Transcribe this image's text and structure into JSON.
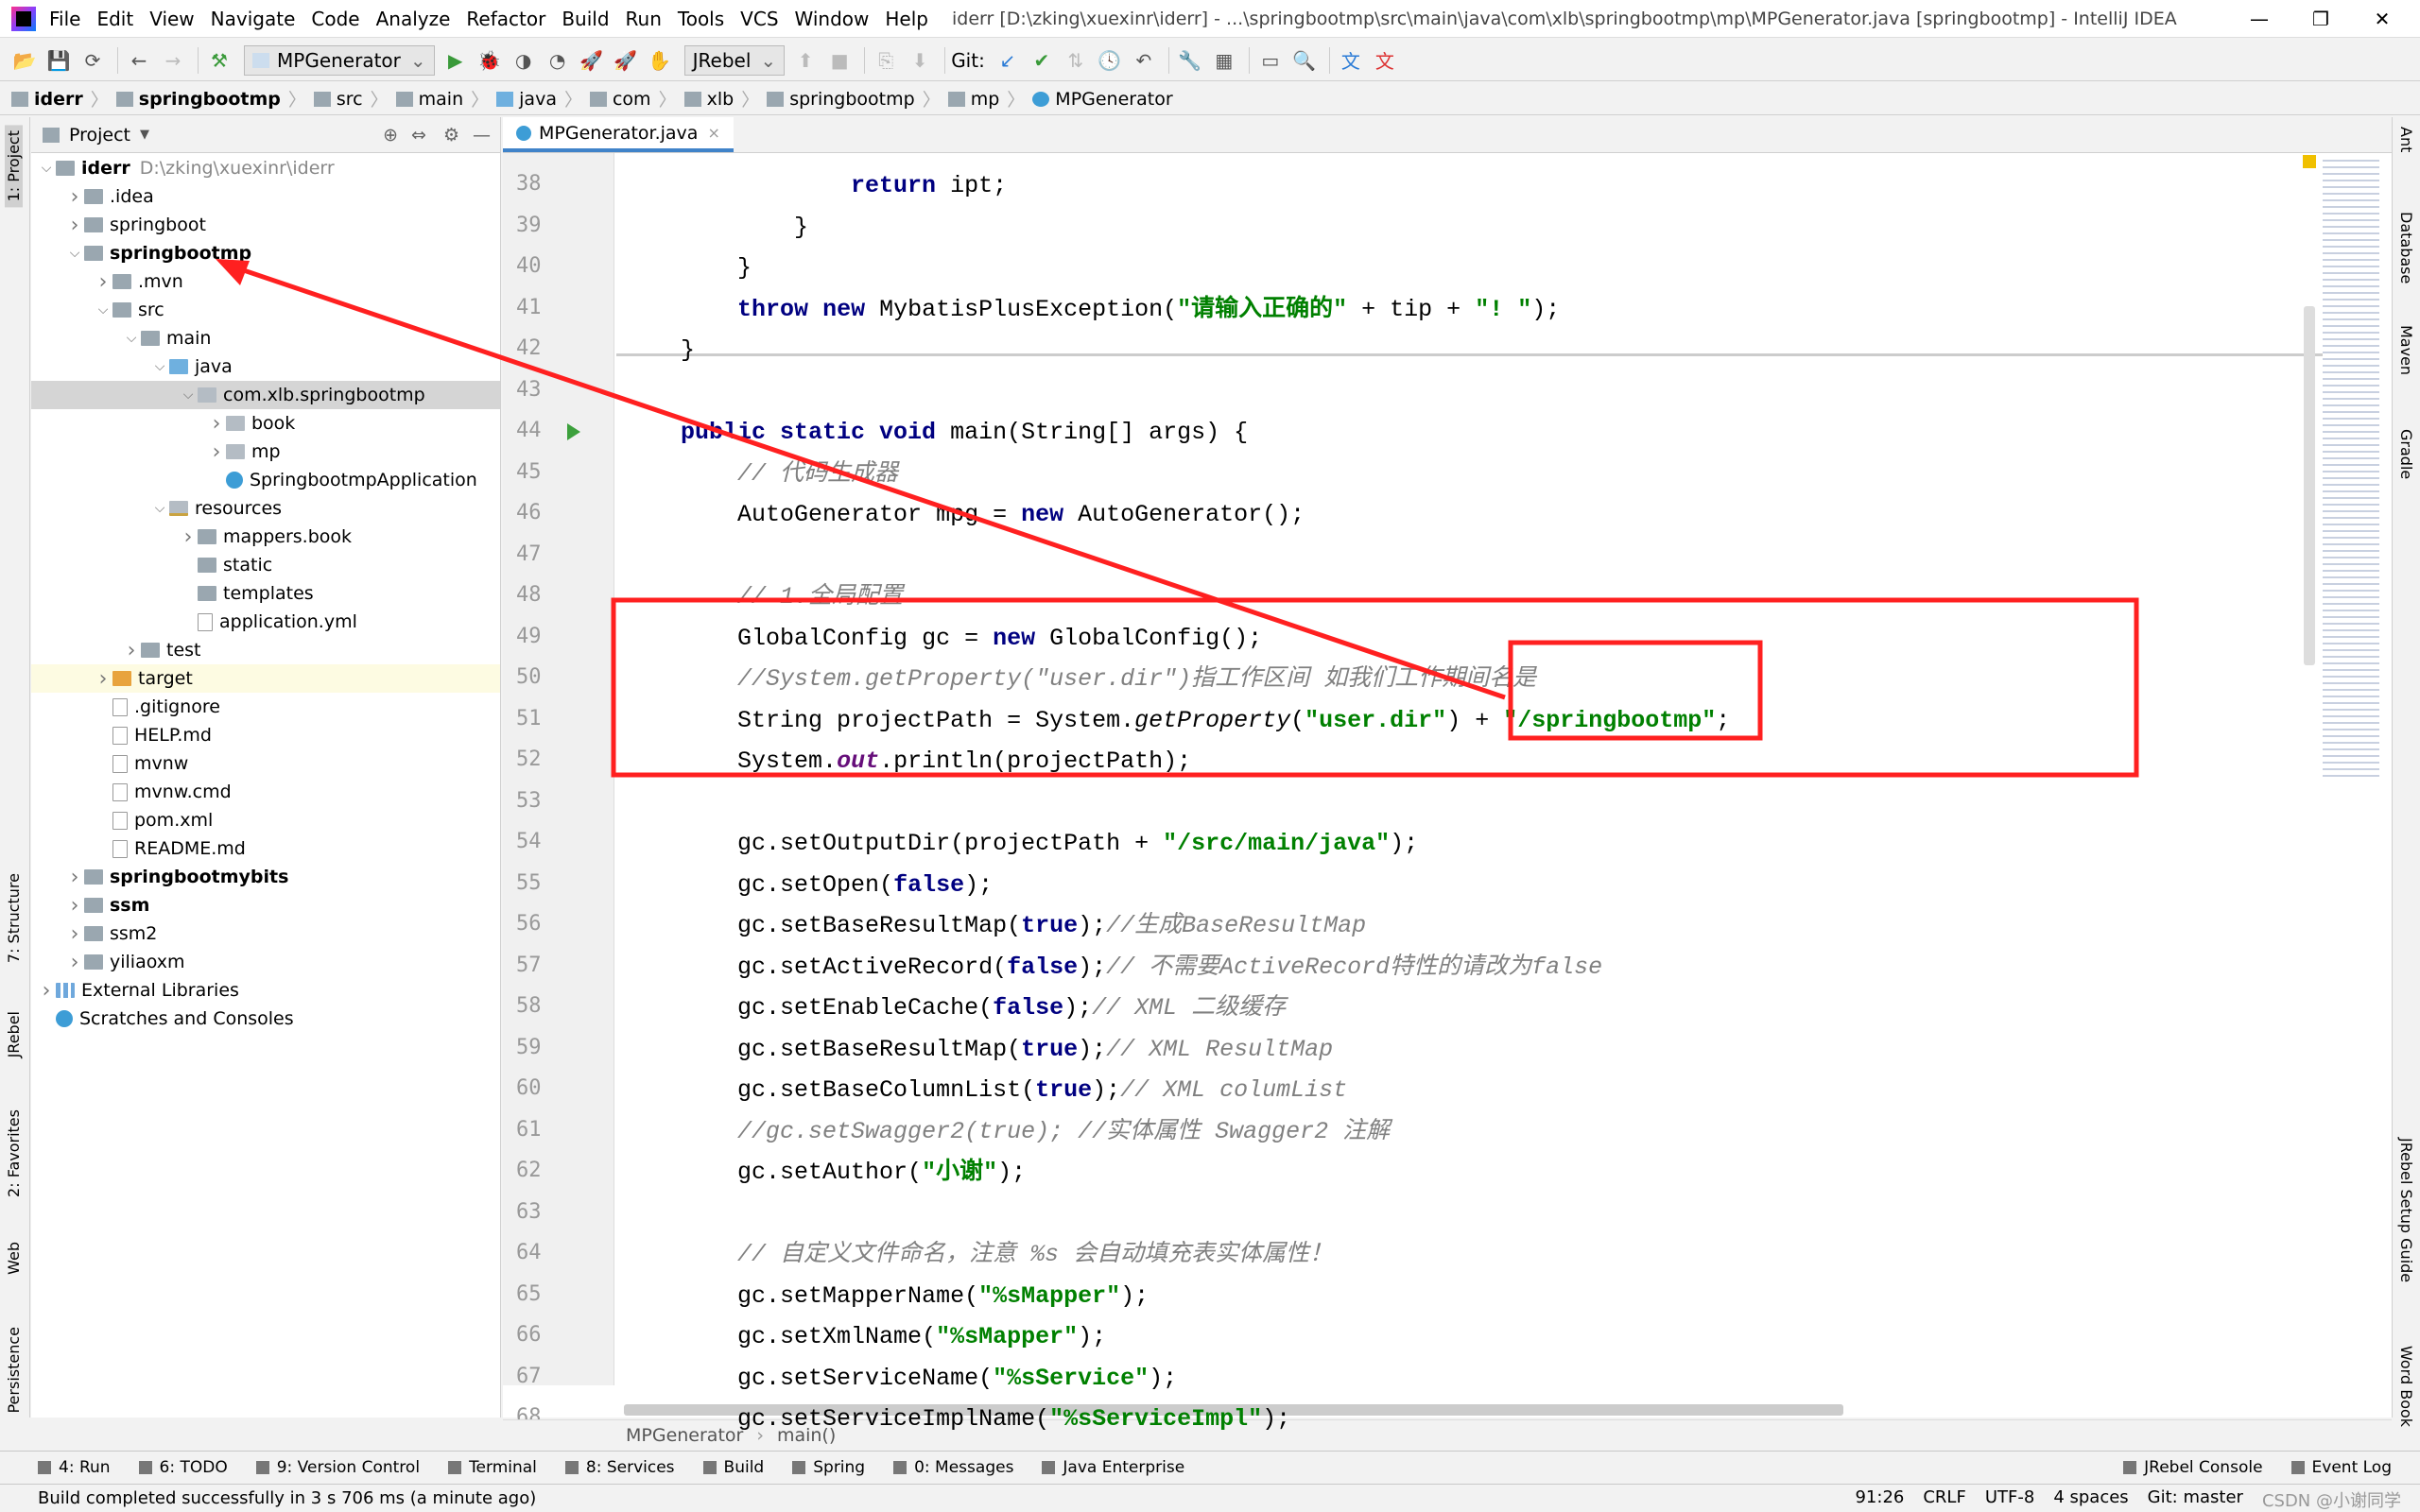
{
  "window": {
    "title": "iderr [D:\\zking\\xuexinr\\iderr] - ...\\springbootmp\\src\\main\\java\\com\\xlb\\springbootmp\\mp\\MPGenerator.java [springbootmp] - IntelliJ IDEA",
    "minimize": "—",
    "maximize": "❐",
    "close": "✕"
  },
  "menu": [
    "File",
    "Edit",
    "View",
    "Navigate",
    "Code",
    "Analyze",
    "Refactor",
    "Build",
    "Run",
    "Tools",
    "VCS",
    "Window",
    "Help"
  ],
  "toolbar": {
    "run_config": "MPGenerator",
    "jrebel": "JRebel",
    "git_label": "Git:"
  },
  "breadcrumb": [
    "iderr",
    "springbootmp",
    "src",
    "main",
    "java",
    "com",
    "xlb",
    "springbootmp",
    "mp",
    "MPGenerator"
  ],
  "project_panel": {
    "title": "Project",
    "tree": [
      {
        "label": "iderr",
        "extra": "D:\\zking\\xuexinr\\iderr",
        "level": 0,
        "arrow": "v",
        "type": "mod",
        "bold": true
      },
      {
        "label": ".idea",
        "level": 1,
        "arrow": ">",
        "type": "dir"
      },
      {
        "label": "springboot",
        "level": 1,
        "arrow": ">",
        "type": "mod"
      },
      {
        "label": "springbootmp",
        "level": 1,
        "arrow": "v",
        "type": "mod",
        "bold": true
      },
      {
        "label": ".mvn",
        "level": 2,
        "arrow": ">",
        "type": "dir"
      },
      {
        "label": "src",
        "level": 2,
        "arrow": "v",
        "type": "dir"
      },
      {
        "label": "main",
        "level": 3,
        "arrow": "v",
        "type": "dir"
      },
      {
        "label": "java",
        "level": 4,
        "arrow": "v",
        "type": "src"
      },
      {
        "label": "com.xlb.springbootmp",
        "level": 5,
        "arrow": "v",
        "type": "pkg",
        "state": "selected"
      },
      {
        "label": "book",
        "level": 6,
        "arrow": ">",
        "type": "pkg"
      },
      {
        "label": "mp",
        "level": 6,
        "arrow": ">",
        "type": "pkg"
      },
      {
        "label": "SpringbootmpApplication",
        "level": 6,
        "arrow": "",
        "type": "cls"
      },
      {
        "label": "resources",
        "level": 4,
        "arrow": "v",
        "type": "res"
      },
      {
        "label": "mappers.book",
        "level": 5,
        "arrow": ">",
        "type": "dir"
      },
      {
        "label": "static",
        "level": 5,
        "arrow": "",
        "type": "dir"
      },
      {
        "label": "templates",
        "level": 5,
        "arrow": "",
        "type": "dir"
      },
      {
        "label": "application.yml",
        "level": 5,
        "arrow": "",
        "type": "file"
      },
      {
        "label": "test",
        "level": 3,
        "arrow": ">",
        "type": "dir"
      },
      {
        "label": "target",
        "level": 2,
        "arrow": ">",
        "type": "target",
        "state": "excluded"
      },
      {
        "label": ".gitignore",
        "level": 2,
        "arrow": "",
        "type": "file"
      },
      {
        "label": "HELP.md",
        "level": 2,
        "arrow": "",
        "type": "file"
      },
      {
        "label": "mvnw",
        "level": 2,
        "arrow": "",
        "type": "file"
      },
      {
        "label": "mvnw.cmd",
        "level": 2,
        "arrow": "",
        "type": "file"
      },
      {
        "label": "pom.xml",
        "level": 2,
        "arrow": "",
        "type": "file"
      },
      {
        "label": "README.md",
        "level": 2,
        "arrow": "",
        "type": "file"
      },
      {
        "label": "springbootmybits",
        "level": 1,
        "arrow": ">",
        "type": "mod",
        "bold": true
      },
      {
        "label": "ssm",
        "level": 1,
        "arrow": ">",
        "type": "mod",
        "bold": true
      },
      {
        "label": "ssm2",
        "level": 1,
        "arrow": ">",
        "type": "mod"
      },
      {
        "label": "yiliaoxm",
        "level": 1,
        "arrow": ">",
        "type": "mod"
      },
      {
        "label": "External Libraries",
        "level": 0,
        "arrow": ">",
        "type": "lib"
      },
      {
        "label": "Scratches and Consoles",
        "level": 0,
        "arrow": "",
        "type": "scr"
      }
    ]
  },
  "editor": {
    "tab": "MPGenerator.java",
    "tab_close": "×",
    "lines": [
      {
        "n": "38",
        "indent": 16,
        "t": [
          [
            "kw",
            "return"
          ],
          [
            "pl",
            " ipt;"
          ]
        ]
      },
      {
        "n": "39",
        "indent": 12,
        "t": [
          [
            "pl",
            "}"
          ]
        ]
      },
      {
        "n": "40",
        "indent": 8,
        "t": [
          [
            "pl",
            "}"
          ]
        ]
      },
      {
        "n": "41",
        "indent": 8,
        "t": [
          [
            "kw",
            "throw"
          ],
          [
            "pl",
            " "
          ],
          [
            "kw",
            "new"
          ],
          [
            "pl",
            " MybatisPlusException("
          ],
          [
            "str",
            "\"请输入正确的\""
          ],
          [
            "pl",
            " + tip + "
          ],
          [
            "str",
            "\"! \""
          ],
          [
            "pl",
            ");"
          ]
        ]
      },
      {
        "n": "42",
        "indent": 4,
        "t": [
          [
            "pl",
            "}"
          ]
        ]
      },
      {
        "n": "43",
        "indent": 0,
        "t": []
      },
      {
        "n": "44",
        "indent": 4,
        "run": true,
        "t": [
          [
            "kw",
            "public static void"
          ],
          [
            "pl",
            " main(String[] args) {"
          ]
        ]
      },
      {
        "n": "45",
        "indent": 8,
        "t": [
          [
            "cm",
            "// 代码生成器"
          ]
        ]
      },
      {
        "n": "46",
        "indent": 8,
        "t": [
          [
            "pl",
            "AutoGenerator mpg = "
          ],
          [
            "kw",
            "new"
          ],
          [
            "pl",
            " AutoGenerator();"
          ]
        ]
      },
      {
        "n": "47",
        "indent": 0,
        "t": []
      },
      {
        "n": "48",
        "indent": 8,
        "t": [
          [
            "cm",
            "// 1.全局配置"
          ]
        ]
      },
      {
        "n": "49",
        "indent": 8,
        "t": [
          [
            "pl",
            "GlobalConfig gc = "
          ],
          [
            "kw",
            "new"
          ],
          [
            "pl",
            " GlobalConfig();"
          ]
        ]
      },
      {
        "n": "50",
        "indent": 8,
        "t": [
          [
            "cm",
            "//System.getProperty(\"user.dir\")指工作区间 如我们工作期间名是"
          ]
        ]
      },
      {
        "n": "51",
        "indent": 8,
        "t": [
          [
            "pl",
            "String projectPath = System."
          ],
          [
            "it",
            "getProperty"
          ],
          [
            "pl",
            "("
          ],
          [
            "str",
            "\"user.dir\""
          ],
          [
            "pl",
            ") + "
          ],
          [
            "str",
            "\"/springbootmp\""
          ],
          [
            "pl",
            ";"
          ]
        ]
      },
      {
        "n": "52",
        "indent": 8,
        "t": [
          [
            "pl",
            "System."
          ],
          [
            "fld",
            "out"
          ],
          [
            "pl",
            ".println(projectPath);"
          ]
        ]
      },
      {
        "n": "53",
        "indent": 0,
        "t": []
      },
      {
        "n": "54",
        "indent": 8,
        "t": [
          [
            "pl",
            "gc.setOutputDir(projectPath + "
          ],
          [
            "str",
            "\"/src/main/java\""
          ],
          [
            "pl",
            ");"
          ]
        ]
      },
      {
        "n": "55",
        "indent": 8,
        "t": [
          [
            "pl",
            "gc.setOpen("
          ],
          [
            "kw",
            "false"
          ],
          [
            "pl",
            ");"
          ]
        ]
      },
      {
        "n": "56",
        "indent": 8,
        "t": [
          [
            "pl",
            "gc.setBaseResultMap("
          ],
          [
            "kw",
            "true"
          ],
          [
            "pl",
            ");"
          ],
          [
            "cm",
            "//生成BaseResultMap"
          ]
        ]
      },
      {
        "n": "57",
        "indent": 8,
        "t": [
          [
            "pl",
            "gc.setActiveRecord("
          ],
          [
            "kw",
            "false"
          ],
          [
            "pl",
            ");"
          ],
          [
            "cm",
            "// 不需要ActiveRecord特性的请改为false"
          ]
        ]
      },
      {
        "n": "58",
        "indent": 8,
        "t": [
          [
            "pl",
            "gc.setEnableCache("
          ],
          [
            "kw",
            "false"
          ],
          [
            "pl",
            ");"
          ],
          [
            "cm",
            "// XML 二级缓存"
          ]
        ]
      },
      {
        "n": "59",
        "indent": 8,
        "t": [
          [
            "pl",
            "gc.setBaseResultMap("
          ],
          [
            "kw",
            "true"
          ],
          [
            "pl",
            ");"
          ],
          [
            "cm",
            "// XML ResultMap"
          ]
        ]
      },
      {
        "n": "60",
        "indent": 8,
        "t": [
          [
            "pl",
            "gc.setBaseColumnList("
          ],
          [
            "kw",
            "true"
          ],
          [
            "pl",
            ");"
          ],
          [
            "cm",
            "// XML columList"
          ]
        ]
      },
      {
        "n": "61",
        "indent": 8,
        "t": [
          [
            "cm",
            "//gc.setSwagger2(true); //实体属性 Swagger2 注解"
          ]
        ]
      },
      {
        "n": "62",
        "indent": 8,
        "t": [
          [
            "pl",
            "gc.setAuthor("
          ],
          [
            "str",
            "\"小谢\""
          ],
          [
            "pl",
            ");"
          ]
        ]
      },
      {
        "n": "63",
        "indent": 0,
        "t": []
      },
      {
        "n": "64",
        "indent": 8,
        "t": [
          [
            "cm",
            "// 自定义文件命名，注意 %s 会自动填充表实体属性！"
          ]
        ]
      },
      {
        "n": "65",
        "indent": 8,
        "t": [
          [
            "pl",
            "gc.setMapperName("
          ],
          [
            "str",
            "\"%sMapper\""
          ],
          [
            "pl",
            ");"
          ]
        ]
      },
      {
        "n": "66",
        "indent": 8,
        "t": [
          [
            "pl",
            "gc.setXmlName("
          ],
          [
            "str",
            "\"%sMapper\""
          ],
          [
            "pl",
            ");"
          ]
        ]
      },
      {
        "n": "67",
        "indent": 8,
        "t": [
          [
            "pl",
            "gc.setServiceName("
          ],
          [
            "str",
            "\"%sService\""
          ],
          [
            "pl",
            ");"
          ]
        ]
      },
      {
        "n": "68",
        "indent": 8,
        "t": [
          [
            "pl",
            "gc.setServiceImplName("
          ],
          [
            "str",
            "\"%sServiceImpl\""
          ],
          [
            "pl",
            ");"
          ]
        ]
      }
    ],
    "breadcrumb": [
      "MPGenerator",
      "main()"
    ]
  },
  "left_strip": [
    "1: Project",
    "7: Structure",
    "JRebel",
    "2: Favorites",
    "Web",
    "Persistence"
  ],
  "right_strip": [
    "Ant",
    "Database",
    "Maven",
    "Gradle",
    "JRebel Setup Guide",
    "Word Book"
  ],
  "tool_windows": [
    "4: Run",
    "6: TODO",
    "9: Version Control",
    "Terminal",
    "8: Services",
    "Build",
    "Spring",
    "0: Messages",
    "Java Enterprise"
  ],
  "tool_windows_right": [
    "JRebel Console",
    "Event Log"
  ],
  "status": {
    "message": "Build completed successfully in 3 s 706 ms (a minute ago)",
    "position": "91:26",
    "line_sep": "CRLF",
    "encoding": "UTF-8",
    "indent": "4 spaces",
    "git": "Git: master",
    "watermark": "CSDN @小谢同学"
  },
  "annotation_color": "#ff2020"
}
